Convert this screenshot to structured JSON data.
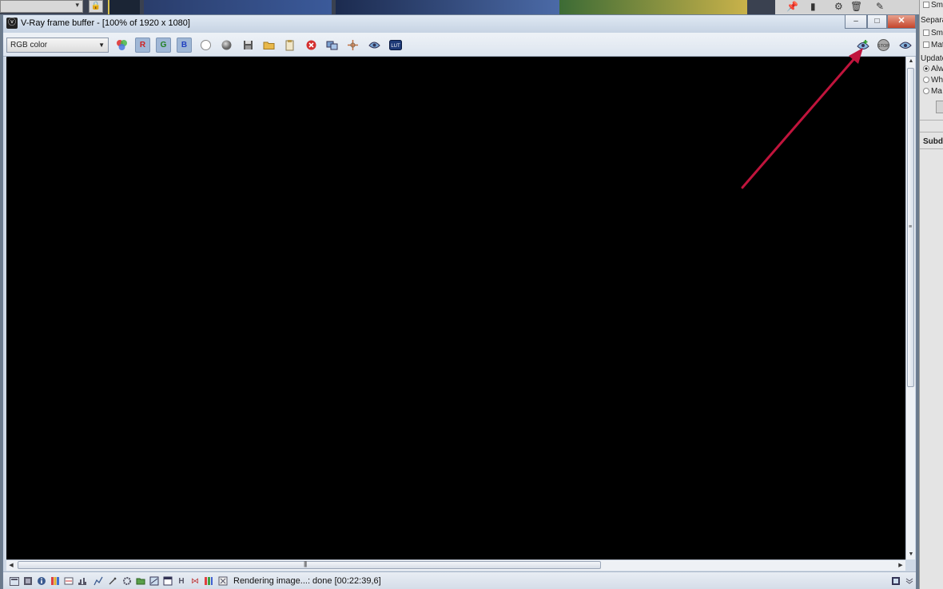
{
  "window": {
    "title": "V-Ray frame buffer - [100% of 1920 x 1080]",
    "minimize_label": "–",
    "maximize_label": "□",
    "close_label": "✕"
  },
  "toolbar": {
    "channel_select": "RGB color",
    "red_channel_label": "R",
    "green_channel_label": "G",
    "blue_channel_label": "B"
  },
  "status": {
    "text": "Rendering image...: done [00:22:39,6]"
  },
  "side_panel": {
    "items": [
      "Smo",
      "Separa",
      "Smo",
      "Mat",
      "Update",
      "Alw",
      "Wh",
      "Ma",
      "Subd"
    ]
  },
  "colors": {
    "window_bg": "#cfd9e6",
    "render_bg": "#000000",
    "annotation_arrow": "#c0143c",
    "close_button": "#c4452b"
  },
  "icons": {
    "toolbar": [
      "color-wheel-icon",
      "red-channel-icon",
      "green-channel-icon",
      "blue-channel-icon",
      "white-circle-icon",
      "gray-circle-icon",
      "save-icon",
      "open-folder-icon",
      "clipboard-icon",
      "clear-icon",
      "duplicate-icon",
      "track-mouse-icon",
      "render-region-icon",
      "lut-icon",
      "render-icon",
      "stop-icon",
      "view-icon"
    ],
    "status": [
      "display-correction-icon",
      "stamp-icon",
      "info-icon",
      "levels-icon",
      "compare-icon",
      "histogram-icon",
      "pixel-info-icon",
      "lens-effects-icon",
      "folder-icon",
      "srgb-icon",
      "window-icon",
      "hue-icon",
      "split-icon",
      "color-icon",
      "ruler-icon",
      "settings-icon",
      "expand-icon"
    ]
  }
}
